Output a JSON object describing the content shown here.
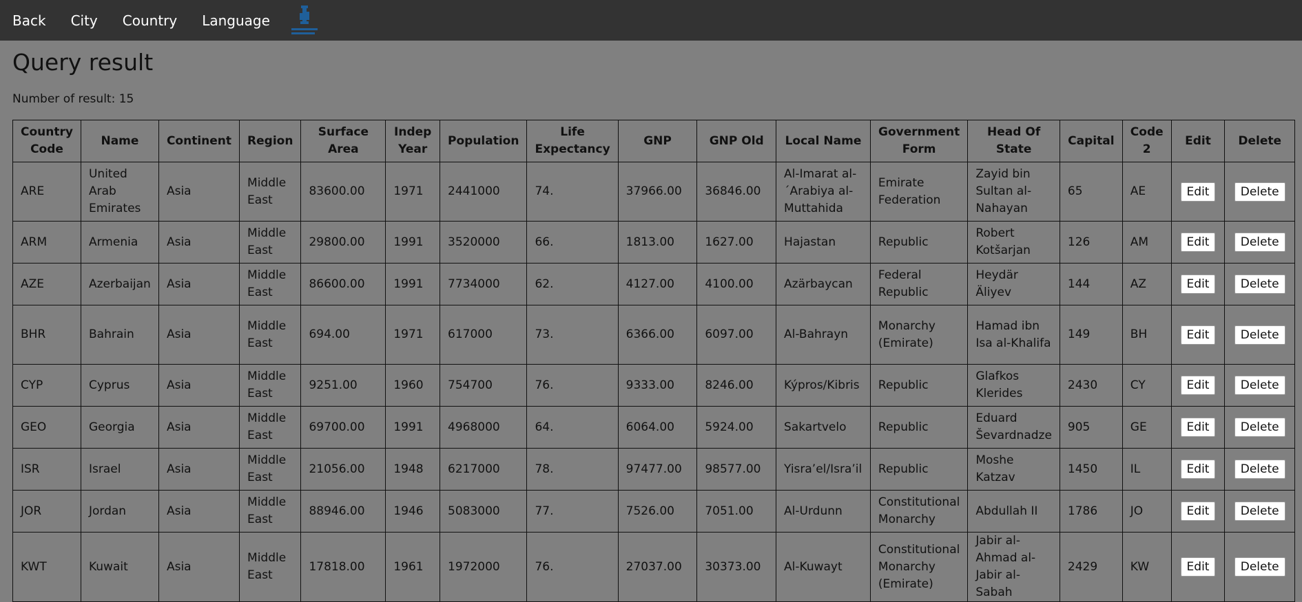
{
  "nav": {
    "items": [
      "Back",
      "City",
      "Country",
      "Language"
    ],
    "logo_icon": "university-logo-icon"
  },
  "page": {
    "title": "Query result",
    "count_text": "Number of result: 15"
  },
  "table": {
    "headers": [
      "Country Code",
      "Name",
      "Continent",
      "Region",
      "Surface Area",
      "Indep Year",
      "Population",
      "Life Expectancy",
      "GNP",
      "GNP Old",
      "Local Name",
      "Government Form",
      "Head Of State",
      "Capital",
      "Code 2",
      "Edit",
      "Delete"
    ],
    "edit_label": "Edit",
    "delete_label": "Delete",
    "rows": [
      [
        "ARE",
        "United Arab Emirates",
        "Asia",
        "Middle East",
        "83600.00",
        "1971",
        "2441000",
        "74.",
        "37966.00",
        "36846.00",
        "Al-Imarat al-´Arabiya al-Muttahida",
        "Emirate Federation",
        "Zayid bin Sultan al-Nahayan",
        "65",
        "AE"
      ],
      [
        "ARM",
        "Armenia",
        "Asia",
        "Middle East",
        "29800.00",
        "1991",
        "3520000",
        "66.",
        "1813.00",
        "1627.00",
        "Hajastan",
        "Republic",
        "Robert Kotšarjan",
        "126",
        "AM"
      ],
      [
        "AZE",
        "Azerbaijan",
        "Asia",
        "Middle East",
        "86600.00",
        "1991",
        "7734000",
        "62.",
        "4127.00",
        "4100.00",
        "Azärbaycan",
        "Federal Republic",
        "Heydär Äliyev",
        "144",
        "AZ"
      ],
      [
        "BHR",
        "Bahrain",
        "Asia",
        "Middle East",
        "694.00",
        "1971",
        "617000",
        "73.",
        "6366.00",
        "6097.00",
        "Al-Bahrayn",
        "Monarchy (Emirate)",
        "Hamad ibn Isa al-Khalifa",
        "149",
        "BH"
      ],
      [
        "CYP",
        "Cyprus",
        "Asia",
        "Middle East",
        "9251.00",
        "1960",
        "754700",
        "76.",
        "9333.00",
        "8246.00",
        "Kýpros/Kibris",
        "Republic",
        "Glafkos Klerides",
        "2430",
        "CY"
      ],
      [
        "GEO",
        "Georgia",
        "Asia",
        "Middle East",
        "69700.00",
        "1991",
        "4968000",
        "64.",
        "6064.00",
        "5924.00",
        "Sakartvelo",
        "Republic",
        "Eduard Ševardnadze",
        "905",
        "GE"
      ],
      [
        "ISR",
        "Israel",
        "Asia",
        "Middle East",
        "21056.00",
        "1948",
        "6217000",
        "78.",
        "97477.00",
        "98577.00",
        "Yisra’el/Isra’il",
        "Republic",
        "Moshe Katzav",
        "1450",
        "IL"
      ],
      [
        "JOR",
        "Jordan",
        "Asia",
        "Middle East",
        "88946.00",
        "1946",
        "5083000",
        "77.",
        "7526.00",
        "7051.00",
        "Al-Urdunn",
        "Constitutional Monarchy",
        "Abdullah II",
        "1786",
        "JO"
      ],
      [
        "KWT",
        "Kuwait",
        "Asia",
        "Middle East",
        "17818.00",
        "1961",
        "1972000",
        "76.",
        "27037.00",
        "30373.00",
        "Al-Kuwayt",
        "Constitutional Monarchy (Emirate)",
        "Jabir al-Ahmad al-Jabir al-Sabah",
        "2429",
        "KW"
      ]
    ]
  }
}
